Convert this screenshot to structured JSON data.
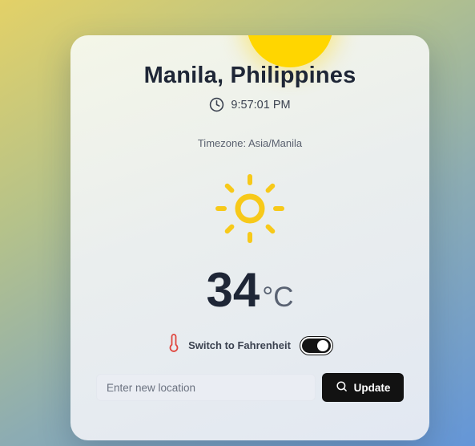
{
  "weather": {
    "city": "Manila, Philippines",
    "time": "9:57:01 PM",
    "timezone_label": "Timezone: Asia/Manila",
    "condition_icon": "sun-icon",
    "temperature": "34",
    "unit": "°C"
  },
  "toggle": {
    "label": "Switch to Fahrenheit",
    "state": "on"
  },
  "search": {
    "placeholder": "Enter new location",
    "value": "",
    "button_label": "Update"
  },
  "colors": {
    "sun": "#ffd600",
    "icon_sun": "#f7c919",
    "thermometer": "#e0463e",
    "button": "#121212",
    "title": "#1e2636"
  }
}
